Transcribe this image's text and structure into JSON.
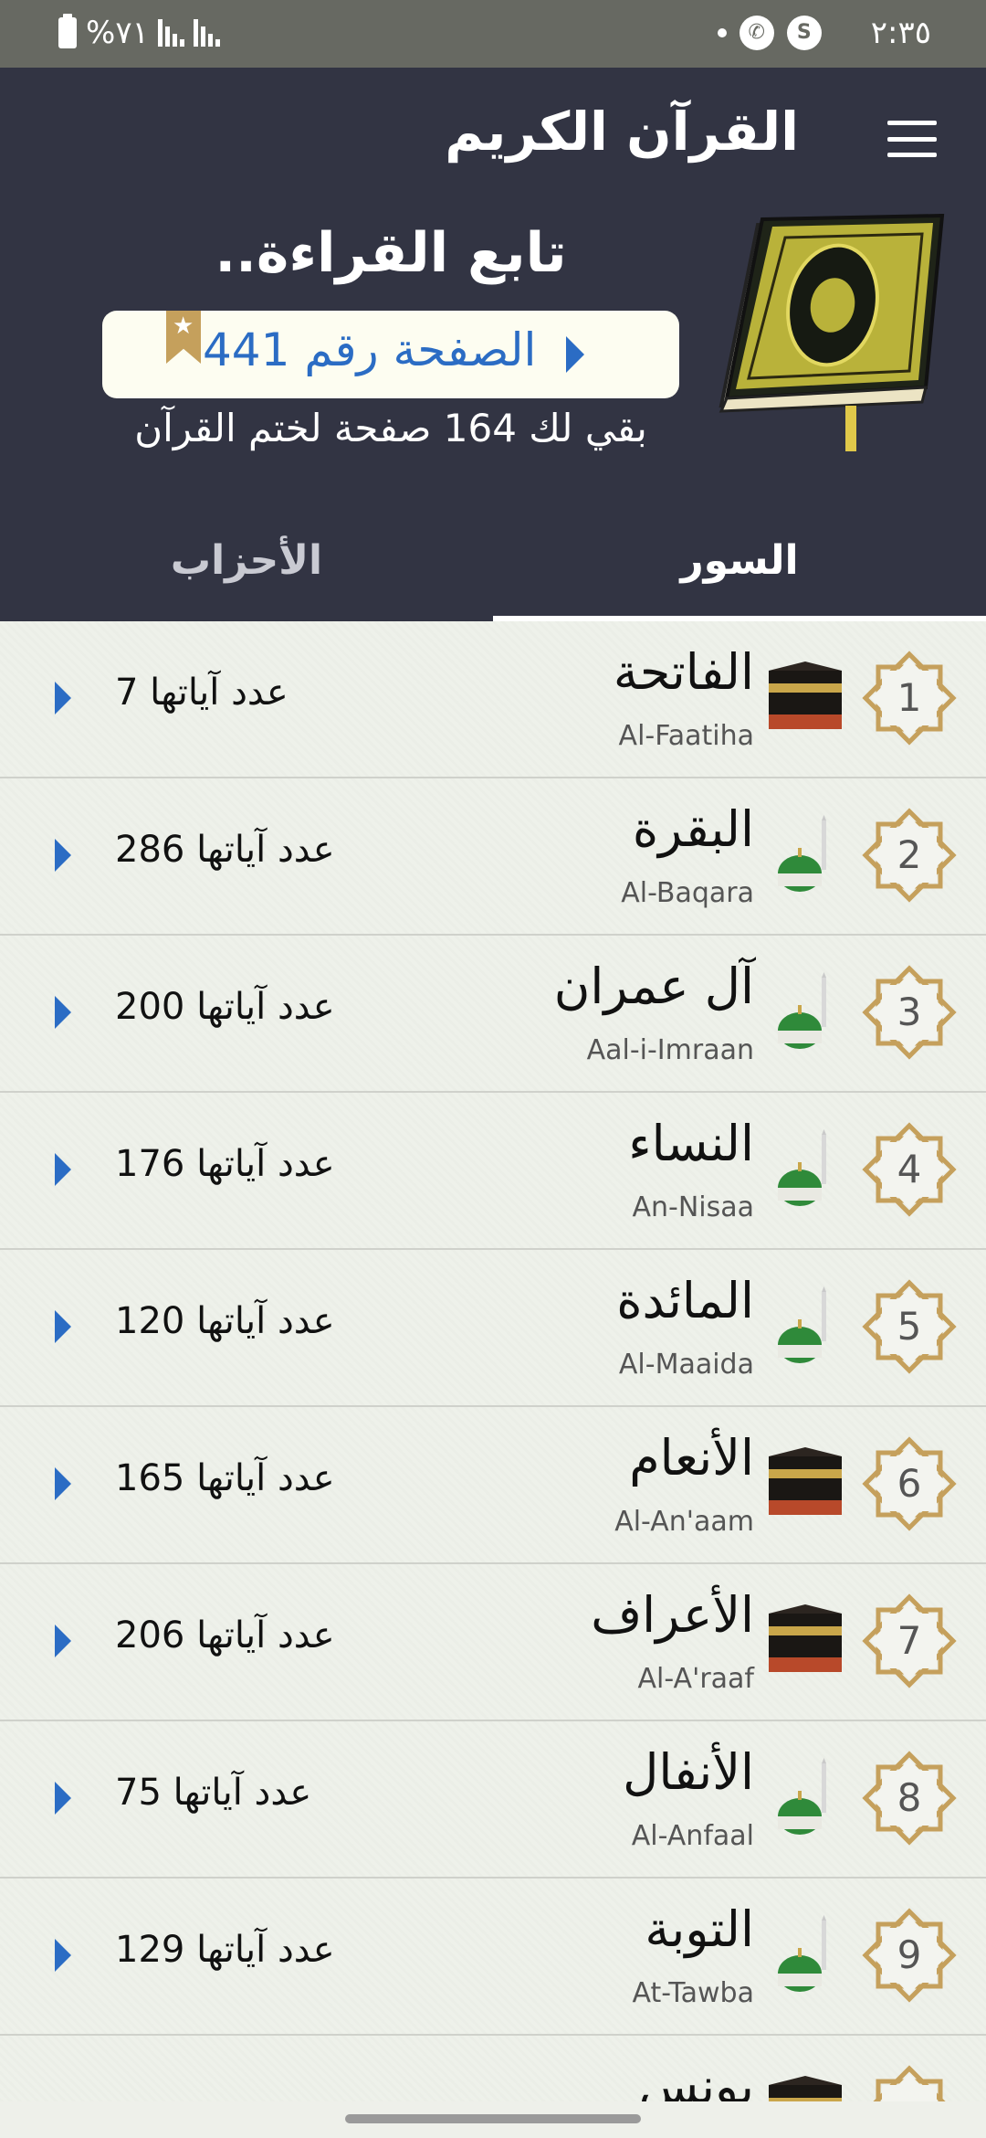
{
  "status_bar": {
    "battery_text": "%٧١",
    "time": "٢:٣٥",
    "app_icon_s": "S"
  },
  "header": {
    "title": "القرآن الكريم",
    "continue_title": "تابع القراءة..",
    "page_button_label": "الصفحة رقم 441",
    "remaining_text": "بقي لك 164 صفحة لختم القرآن"
  },
  "tabs": {
    "surahs": "السور",
    "ahzab": "الأحزاب"
  },
  "colors": {
    "header_bg": "#323443",
    "accent_blue": "#2b6cc4",
    "star_gold": "#c5a05c"
  },
  "surahs": [
    {
      "num": "1",
      "ar": "الفاتحة",
      "en": "Al-Faatiha",
      "ayat": "عدد آياتها 7",
      "place": "kaaba-icon"
    },
    {
      "num": "2",
      "ar": "البقرة",
      "en": "Al-Baqara",
      "ayat": "عدد آياتها 286",
      "place": "mosque-dome-icon"
    },
    {
      "num": "3",
      "ar": "آل عمران",
      "en": "Aal-i-Imraan",
      "ayat": "عدد آياتها 200",
      "place": "mosque-dome-icon"
    },
    {
      "num": "4",
      "ar": "النساء",
      "en": "An-Nisaa",
      "ayat": "عدد آياتها 176",
      "place": "mosque-dome-icon"
    },
    {
      "num": "5",
      "ar": "المائدة",
      "en": "Al-Maaida",
      "ayat": "عدد آياتها 120",
      "place": "mosque-dome-icon"
    },
    {
      "num": "6",
      "ar": "الأنعام",
      "en": "Al-An'aam",
      "ayat": "عدد آياتها 165",
      "place": "kaaba-icon"
    },
    {
      "num": "7",
      "ar": "الأعراف",
      "en": "Al-A'raaf",
      "ayat": "عدد آياتها 206",
      "place": "kaaba-icon"
    },
    {
      "num": "8",
      "ar": "الأنفال",
      "en": "Al-Anfaal",
      "ayat": "عدد آياتها 75",
      "place": "mosque-dome-icon"
    },
    {
      "num": "9",
      "ar": "التوبة",
      "en": "At-Tawba",
      "ayat": "عدد آياتها 129",
      "place": "mosque-dome-icon"
    },
    {
      "num": "",
      "ar": "يونس",
      "en": "",
      "ayat": "",
      "place": "kaaba-icon"
    }
  ]
}
